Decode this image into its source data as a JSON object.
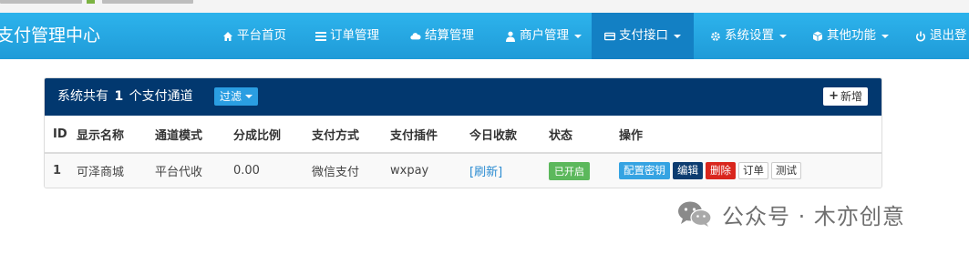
{
  "navbar": {
    "brand": "支付管理中心",
    "items": [
      {
        "label": "平台首页",
        "icon": "home-icon"
      },
      {
        "label": "订单管理",
        "icon": "list-icon"
      },
      {
        "label": "结算管理",
        "icon": "cloud-icon"
      },
      {
        "label": "商户管理",
        "icon": "user-icon"
      },
      {
        "label": "支付接口",
        "icon": "credit-card-icon",
        "active": true
      },
      {
        "label": "系统设置",
        "icon": "gear-icon"
      },
      {
        "label": "其他功能",
        "icon": "cube-icon"
      },
      {
        "label": "退出登",
        "icon": "power-icon"
      }
    ]
  },
  "panel": {
    "title_prefix": "系统共有",
    "count": "1",
    "title_suffix": "个支付通道",
    "filter_label": "过滤",
    "new_label": "新增"
  },
  "table": {
    "headers": [
      "ID",
      "显示名称",
      "通道模式",
      "分成比例",
      "支付方式",
      "支付插件",
      "今日收款",
      "状态",
      "操作"
    ],
    "rows": [
      {
        "id": "1",
        "name": "可泽商城",
        "mode": "平台代收",
        "ratio": "0.00",
        "method": "微信支付",
        "plugin": "wxpay",
        "today": "[刷新]",
        "status": "已开启",
        "actions": [
          "配置密钥",
          "编辑",
          "删除",
          "订单",
          "测试"
        ]
      }
    ]
  },
  "watermark": {
    "text": "公众号 · 木亦创意",
    "icon": "wechat-icon"
  },
  "colors": {
    "navbar": "#1f9bd8",
    "navbar_active": "#1380c4",
    "panel_head": "#02386f",
    "status_on": "#5cb85c",
    "delete": "#d9261d"
  }
}
